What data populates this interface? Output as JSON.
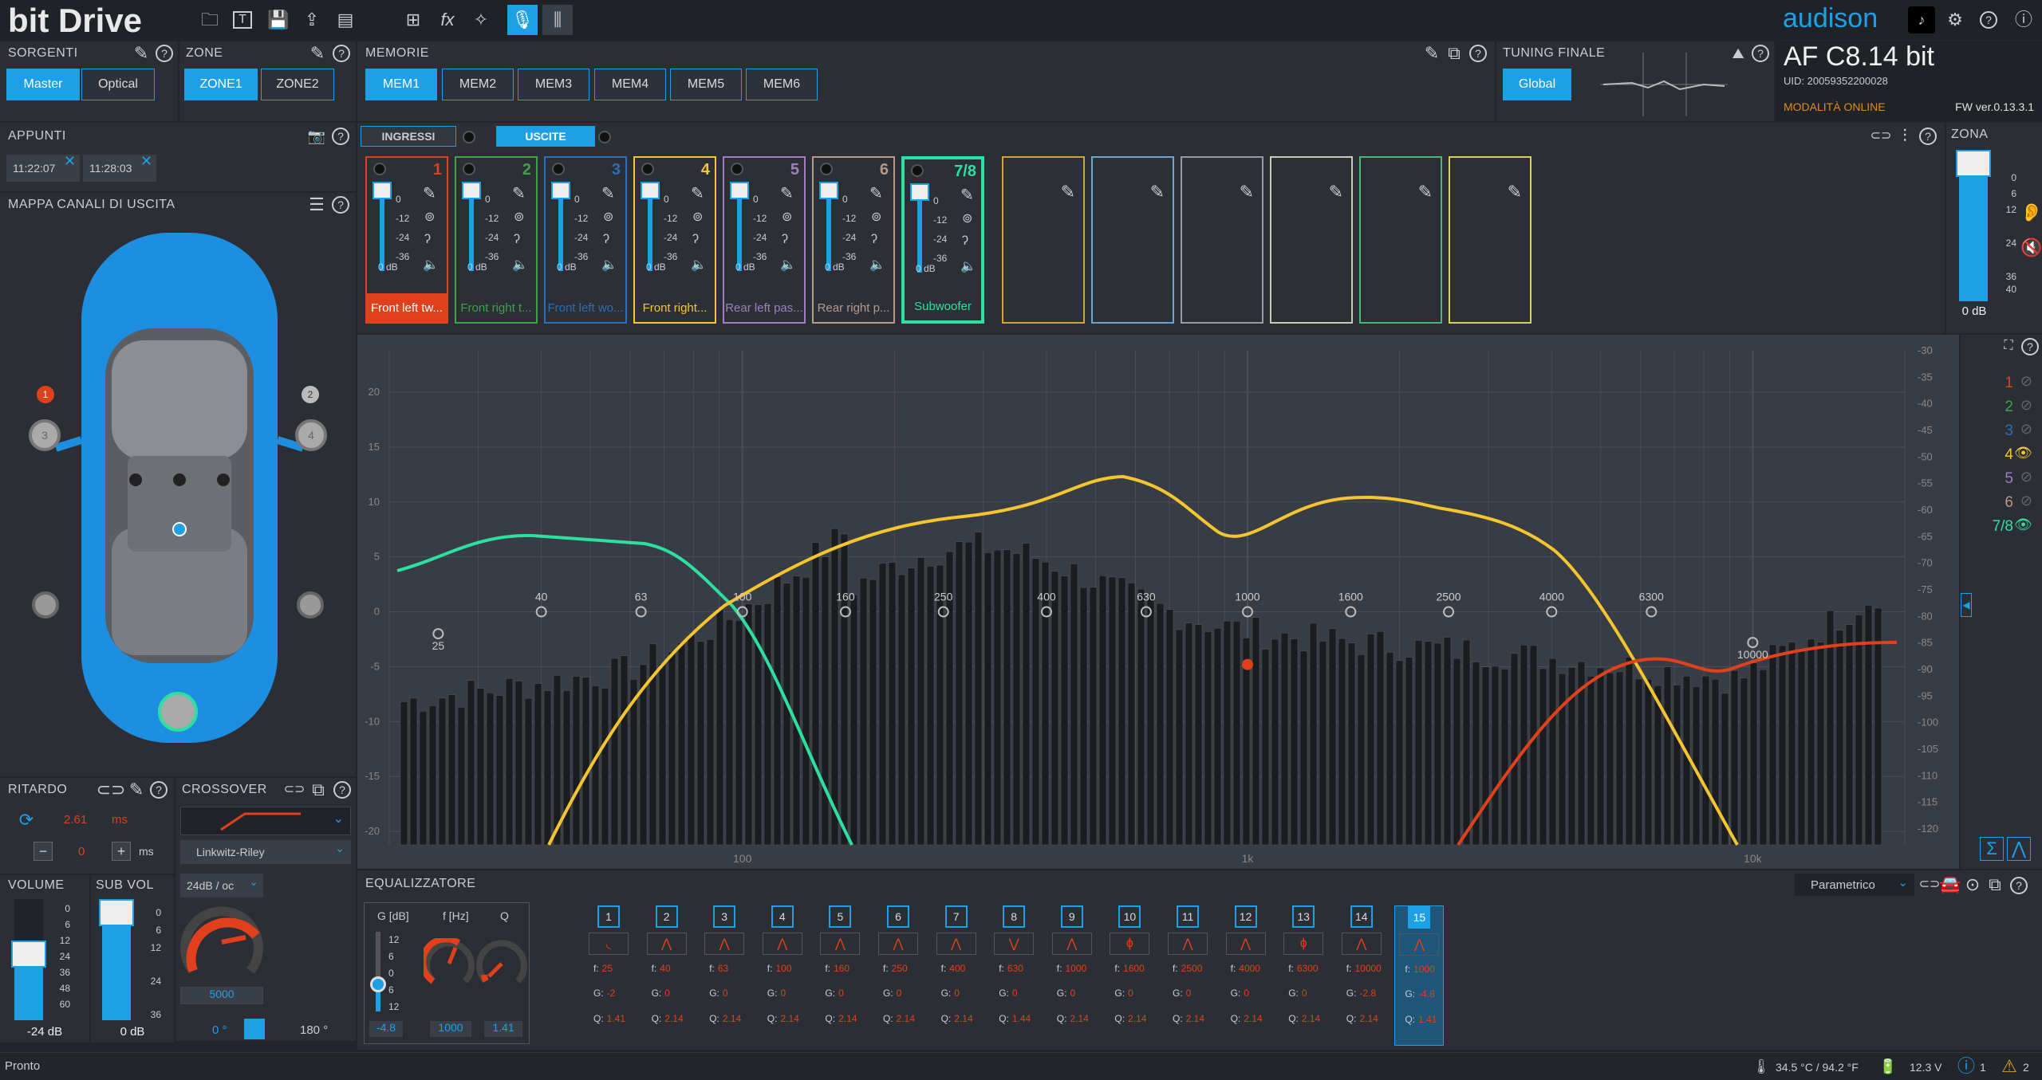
{
  "app": {
    "name": "bit Drive",
    "brand": "audison",
    "device": "AF C8.14 bit",
    "uid": "UID: 20059352200028",
    "mode": "MODALITÀ ONLINE",
    "fw": "FW ver.0.13.3.1"
  },
  "sorgenti": {
    "title": "SORGENTI",
    "items": [
      "Master",
      "Optical"
    ]
  },
  "zone": {
    "title": "ZONE",
    "items": [
      "ZONE1",
      "ZONE2"
    ]
  },
  "memorie": {
    "title": "MEMORIE",
    "items": [
      "MEM1",
      "MEM2",
      "MEM3",
      "MEM4",
      "MEM5",
      "MEM6"
    ]
  },
  "tuning": {
    "title": "TUNING FINALE",
    "button": "Global"
  },
  "appunti": {
    "title": "APPUNTI",
    "items": [
      "11:22:07",
      "11:28:03"
    ]
  },
  "mappa": {
    "title": "MAPPA CANALI DI USCITA",
    "badges": [
      "1",
      "2",
      "3",
      "4"
    ]
  },
  "tabs": {
    "ingressi": "INGRESSI",
    "uscite": "USCITE"
  },
  "channels": [
    {
      "num": "1",
      "name": "Front left tw...",
      "color": "#e0401b",
      "db": "0 dB"
    },
    {
      "num": "2",
      "name": "Front right t...",
      "color": "#3fa24a",
      "db": "0 dB"
    },
    {
      "num": "3",
      "name": "Front left wo...",
      "color": "#2a6fb8",
      "db": "0 dB"
    },
    {
      "num": "4",
      "name": "Front right...",
      "color": "#f3c531",
      "db": "0 dB"
    },
    {
      "num": "5",
      "name": "Rear left pas...",
      "color": "#a07fc0",
      "db": "0 dB"
    },
    {
      "num": "6",
      "name": "Rear right p...",
      "color": "#b49a8a",
      "db": "0 dB"
    },
    {
      "num": "7/8",
      "name": "Subwoofer",
      "color": "#2ee0a0",
      "db": "0 dB"
    }
  ],
  "strip_ticks": [
    "0",
    "-12",
    "-24",
    "-36"
  ],
  "zona": {
    "title": "ZONA",
    "ticks": [
      "0",
      "6",
      "12",
      "24",
      "36",
      "40"
    ],
    "value": "0 dB"
  },
  "graph": {
    "y_left": [
      "20",
      "15",
      "10",
      "5",
      "0",
      "-5",
      "-10",
      "-15",
      "-20"
    ],
    "y_right": [
      "-30",
      "-35",
      "-40",
      "-45",
      "-50",
      "-55",
      "-60",
      "-65",
      "-70",
      "-75",
      "-80",
      "-85",
      "-90",
      "-95",
      "-100",
      "-105",
      "-110",
      "-115",
      "-120"
    ],
    "x_labels": [
      "100",
      "1k",
      "10k"
    ],
    "band_freqs": [
      "25",
      "40",
      "63",
      "100",
      "160",
      "250",
      "400",
      "630",
      "1000",
      "1600",
      "2500",
      "4000",
      "6300",
      "10000"
    ]
  },
  "legend": [
    {
      "label": "1",
      "color": "#e0401b",
      "visible": false
    },
    {
      "label": "2",
      "color": "#3fa24a",
      "visible": false
    },
    {
      "label": "3",
      "color": "#2a6fb8",
      "visible": false
    },
    {
      "label": "4",
      "color": "#f3c531",
      "visible": true
    },
    {
      "label": "5",
      "color": "#a07fc0",
      "visible": false
    },
    {
      "label": "6",
      "color": "#b49a8a",
      "visible": false
    },
    {
      "label": "7/8",
      "color": "#2ee0a0",
      "visible": true
    }
  ],
  "ritardo": {
    "title": "RITARDO",
    "value": "2.61",
    "unit": "ms",
    "step": "0",
    "step_unit": "ms"
  },
  "crossover": {
    "title": "CROSSOVER",
    "type": "Linkwitz-Riley",
    "slope": "24dB / oc",
    "freq": "5000",
    "phase0": "0 °",
    "phase180": "180 °"
  },
  "volume": {
    "title": "VOLUME",
    "ticks": [
      "0",
      "6",
      "12",
      "24",
      "36",
      "48",
      "60"
    ],
    "value": "-24 dB"
  },
  "subvol": {
    "title": "SUB VOL",
    "ticks": [
      "0",
      "6",
      "12",
      "24",
      "36"
    ],
    "value": "0 dB"
  },
  "eq": {
    "title": "EQUALIZZATORE",
    "mode": "Parametrico",
    "g_label": "G [dB]",
    "f_label": "f [Hz]",
    "q_label": "Q",
    "g_ticks": [
      "12",
      "6",
      "0",
      "6",
      "12"
    ],
    "g": "-4.8",
    "f": "1000",
    "q": "1.41",
    "bands": [
      {
        "n": "1",
        "f": "25",
        "g": "-2",
        "q": "1.41",
        "sym": "◟"
      },
      {
        "n": "2",
        "f": "40",
        "g": "0",
        "q": "2.14",
        "sym": "⋀"
      },
      {
        "n": "3",
        "f": "63",
        "g": "0",
        "q": "2.14",
        "sym": "⋀"
      },
      {
        "n": "4",
        "f": "100",
        "g": "0",
        "q": "2.14",
        "sym": "⋀"
      },
      {
        "n": "5",
        "f": "160",
        "g": "0",
        "q": "2.14",
        "sym": "⋀"
      },
      {
        "n": "6",
        "f": "250",
        "g": "0",
        "q": "2.14",
        "sym": "⋀"
      },
      {
        "n": "7",
        "f": "400",
        "g": "0",
        "q": "2.14",
        "sym": "⋀"
      },
      {
        "n": "8",
        "f": "630",
        "g": "0",
        "q": "1.44",
        "sym": "⋁"
      },
      {
        "n": "9",
        "f": "1000",
        "g": "0",
        "q": "2.14",
        "sym": "⋀"
      },
      {
        "n": "10",
        "f": "1600",
        "g": "0",
        "q": "2.14",
        "sym": "ɸ"
      },
      {
        "n": "11",
        "f": "2500",
        "g": "0",
        "q": "2.14",
        "sym": "⋀"
      },
      {
        "n": "12",
        "f": "4000",
        "g": "0",
        "q": "2.14",
        "sym": "⋀"
      },
      {
        "n": "13",
        "f": "6300",
        "g": "0",
        "q": "2.14",
        "sym": "ɸ"
      },
      {
        "n": "14",
        "f": "10000",
        "g": "-2.8",
        "q": "2.14",
        "sym": "⋀"
      },
      {
        "n": "15",
        "f": "1000",
        "g": "-4.8",
        "q": "1.41",
        "sym": "⋀"
      }
    ]
  },
  "status": {
    "text": "Pronto",
    "temp": "34.5 °C / 94.2 °F",
    "volt": "12.3 V",
    "info": "1",
    "warn": "2"
  }
}
